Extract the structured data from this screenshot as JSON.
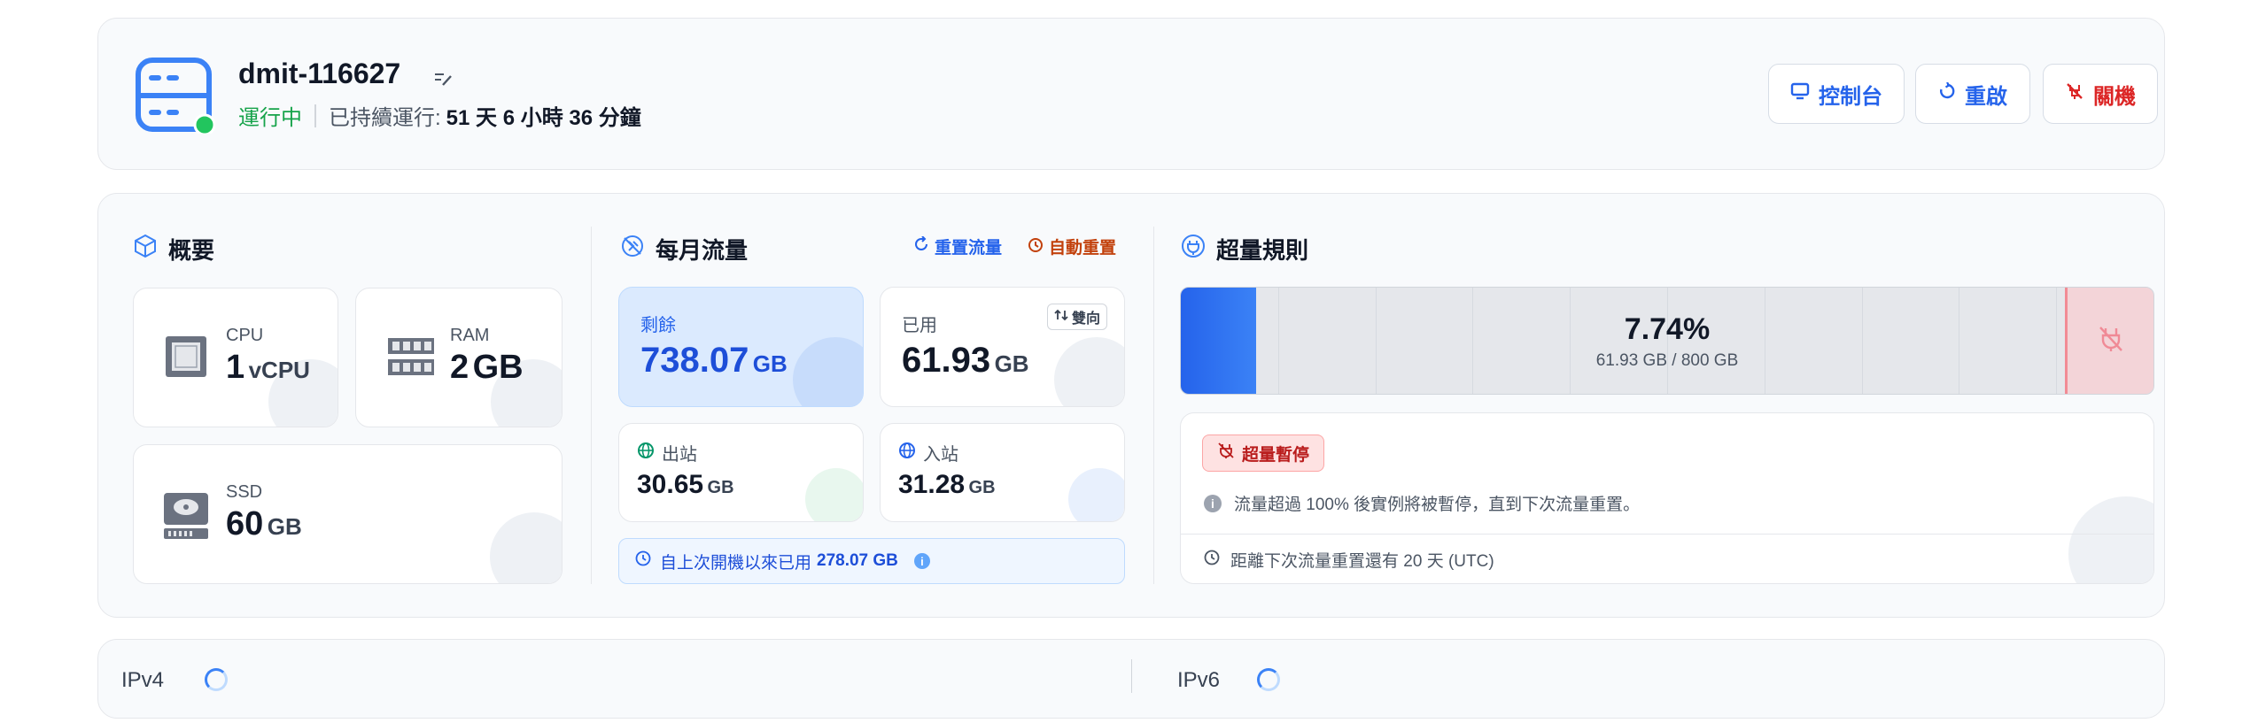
{
  "header": {
    "server_name": "dmit-116627",
    "status": "運行中",
    "uptime_label": "已持續運行:",
    "uptime_value": "51 天 6 小時 36 分鐘",
    "buttons": {
      "console": "控制台",
      "reboot": "重啟",
      "shutdown": "關機"
    }
  },
  "overview": {
    "title": "概要",
    "cpu": {
      "label": "CPU",
      "value": "1",
      "unit": "vCPU"
    },
    "ram": {
      "label": "RAM",
      "value": "2",
      "unit": "GB"
    },
    "ssd": {
      "label": "SSD",
      "value": "60",
      "unit": "GB"
    }
  },
  "traffic": {
    "title": "每月流量",
    "reset_label": "重置流量",
    "auto_reset_label": "自動重置",
    "remaining": {
      "label": "剩餘",
      "value": "738.07",
      "unit": "GB"
    },
    "used": {
      "label": "已用",
      "value": "61.93",
      "unit": "GB",
      "toggle": "雙向"
    },
    "outbound": {
      "label": "出站",
      "value": "30.65",
      "unit": "GB"
    },
    "inbound": {
      "label": "入站",
      "value": "31.28",
      "unit": "GB"
    },
    "since_boot_label": "自上次開機以來已用",
    "since_boot_value": "278.07 GB"
  },
  "overage": {
    "title": "超量規則",
    "percent_text": "7.74%",
    "percent_value": 7.74,
    "usage_text": "61.93 GB / 800 GB",
    "badge": "超量暫停",
    "info_text": "流量超過 100% 後實例將被暫停，直到下次流量重置。",
    "reset_info": "距離下次流量重置還有 20 天 (UTC)"
  },
  "ip": {
    "ipv4_label": "IPv4",
    "ipv6_label": "IPv6"
  },
  "colors": {
    "blue": "#2563eb",
    "green": "#16a34a",
    "red": "#dc2626",
    "orange": "#c2410c"
  }
}
